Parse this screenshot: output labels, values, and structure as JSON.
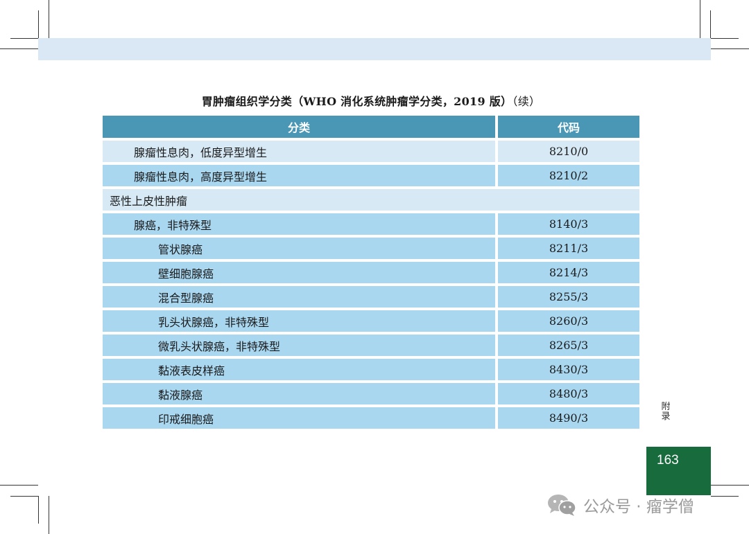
{
  "title": {
    "main": "胃肿瘤组织学分类（WHO 消化系统肿瘤学分类，2019 版）",
    "continued": "（续）"
  },
  "table": {
    "headers": [
      "分类",
      "代码"
    ],
    "rows": [
      {
        "level": 1,
        "name": "腺瘤性息肉，低度异型增生",
        "code": "8210/0"
      },
      {
        "level": 1,
        "name": "腺瘤性息肉，高度异型增生",
        "code": "8210/2"
      },
      {
        "level": 0,
        "name": "恶性上皮性肿瘤",
        "code": ""
      },
      {
        "level": 1,
        "name": "腺癌，非特殊型",
        "code": "8140/3"
      },
      {
        "level": 2,
        "name": "管状腺癌",
        "code": "8211/3"
      },
      {
        "level": 2,
        "name": "壁细胞腺癌",
        "code": "8214/3"
      },
      {
        "level": 2,
        "name": "混合型腺癌",
        "code": "8255/3"
      },
      {
        "level": 2,
        "name": "乳头状腺癌，非特殊型",
        "code": "8260/3"
      },
      {
        "level": 2,
        "name": "微乳头状腺癌，非特殊型",
        "code": "8265/3"
      },
      {
        "level": 2,
        "name": "黏液表皮样癌",
        "code": "8430/3"
      },
      {
        "level": 2,
        "name": "黏液腺癌",
        "code": "8480/3"
      },
      {
        "level": 2,
        "name": "印戒细胞癌",
        "code": "8490/3"
      }
    ]
  },
  "side_label": "附录",
  "page_number": "163",
  "watermark": {
    "text": "公众号 · 瘤学僧",
    "icon": "wechat-icon"
  },
  "colors": {
    "header_band": "#d9e8f4",
    "table_header": "#4a97b5",
    "row_light": "#d6e9f5",
    "row_mid": "#a9d7f0",
    "page_box": "#176b3c"
  }
}
